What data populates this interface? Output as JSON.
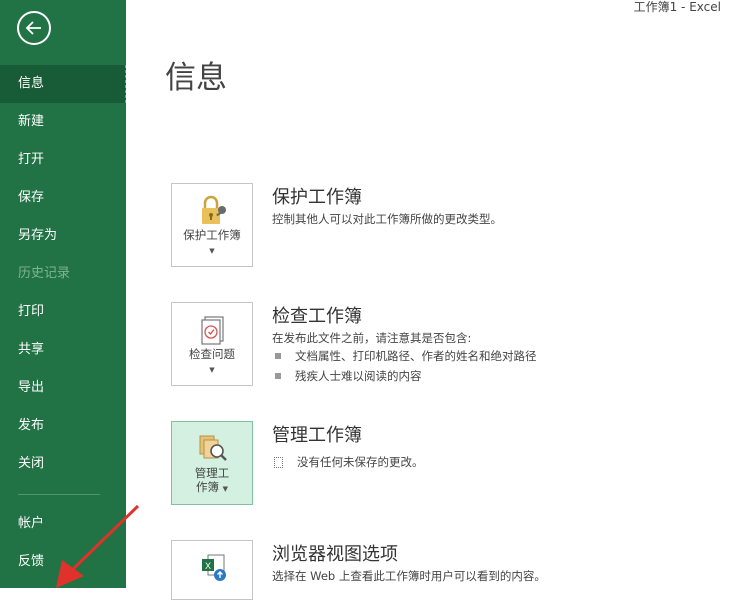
{
  "window": {
    "title": "工作簿1  -  Excel"
  },
  "sidebar": {
    "items": [
      {
        "label": "信息"
      },
      {
        "label": "新建"
      },
      {
        "label": "打开"
      },
      {
        "label": "保存"
      },
      {
        "label": "另存为"
      },
      {
        "label": "历史记录"
      },
      {
        "label": "打印"
      },
      {
        "label": "共享"
      },
      {
        "label": "导出"
      },
      {
        "label": "发布"
      },
      {
        "label": "关闭"
      },
      {
        "label": "帐户"
      },
      {
        "label": "反馈"
      }
    ]
  },
  "main": {
    "title": "信息",
    "sections": [
      {
        "tile_label": "保护工作簿",
        "title": "保护工作簿",
        "desc": "控制其他人可以对此工作簿所做的更改类型。"
      },
      {
        "tile_label": "检查问题",
        "title": "检查工作簿",
        "desc": "在发布此文件之前，请注意其是否包含:",
        "bullets": [
          "文档属性、打印机路径、作者的姓名和绝对路径",
          "残疾人士难以阅读的内容"
        ]
      },
      {
        "tile_label_line1": "管理工",
        "tile_label_line2": "作簿",
        "title": "管理工作簿",
        "status": "没有任何未保存的更改。"
      },
      {
        "title": "浏览器视图选项",
        "desc": "选择在 Web 上查看此工作簿时用户可以看到的内容。"
      }
    ]
  },
  "colors": {
    "sidebar": "#217346",
    "sidebar_active": "#185c37",
    "annotation": "#e0312b"
  }
}
